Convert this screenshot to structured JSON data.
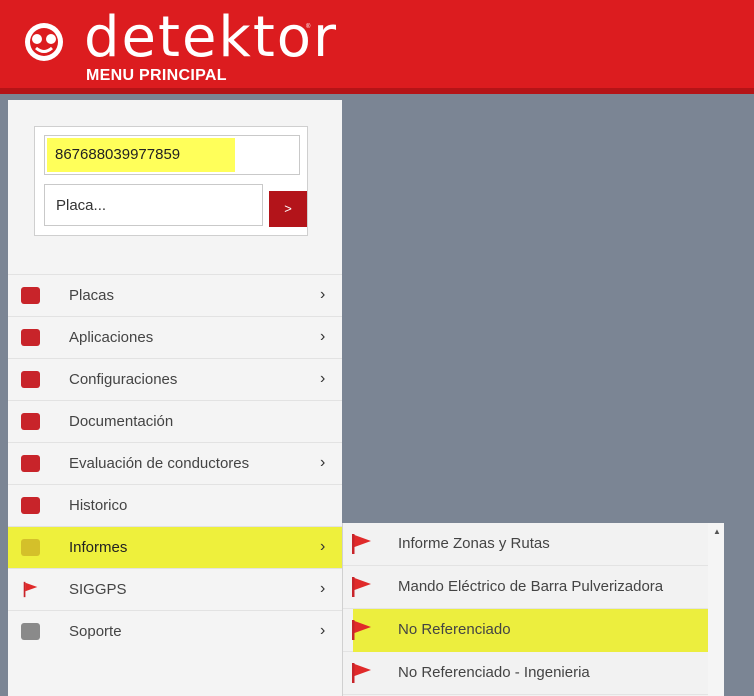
{
  "header": {
    "logo_text": "detektor",
    "subtitle": "MENU PRINCIPAL",
    "reg_mark": "®"
  },
  "search": {
    "imei_value": "867688039977859",
    "plate_placeholder": "Placa...",
    "go_label": ">"
  },
  "menu": {
    "items": [
      {
        "label": "Placas",
        "icon": "plate-icon",
        "has_submenu": true
      },
      {
        "label": "Aplicaciones",
        "icon": "box-icon",
        "has_submenu": true
      },
      {
        "label": "Configuraciones",
        "icon": "gear-icon",
        "has_submenu": true
      },
      {
        "label": "Documentación",
        "icon": "document-icon",
        "has_submenu": false
      },
      {
        "label": "Evaluación de conductores",
        "icon": "box-icon",
        "has_submenu": true
      },
      {
        "label": "Historico",
        "icon": "dots-icon",
        "has_submenu": false
      },
      {
        "label": "Informes",
        "icon": "folder-icon",
        "has_submenu": true
      },
      {
        "label": "SIGGPS",
        "icon": "flag-icon",
        "has_submenu": true
      },
      {
        "label": "Soporte",
        "icon": "wrench-icon",
        "has_submenu": true
      }
    ],
    "arrow": "›"
  },
  "submenu": {
    "items": [
      {
        "label": "Informe Zonas y Rutas"
      },
      {
        "label": "Mando Eléctrico de Barra Pulverizadora"
      },
      {
        "label": "No Referenciado"
      },
      {
        "label": "No Referenciado - Ingenieria"
      }
    ],
    "scroll_up": "▲"
  },
  "colors": {
    "brand_red": "#dc1c1f",
    "highlight_yellow": "#ecee3e",
    "backdrop": "#7b8594"
  }
}
